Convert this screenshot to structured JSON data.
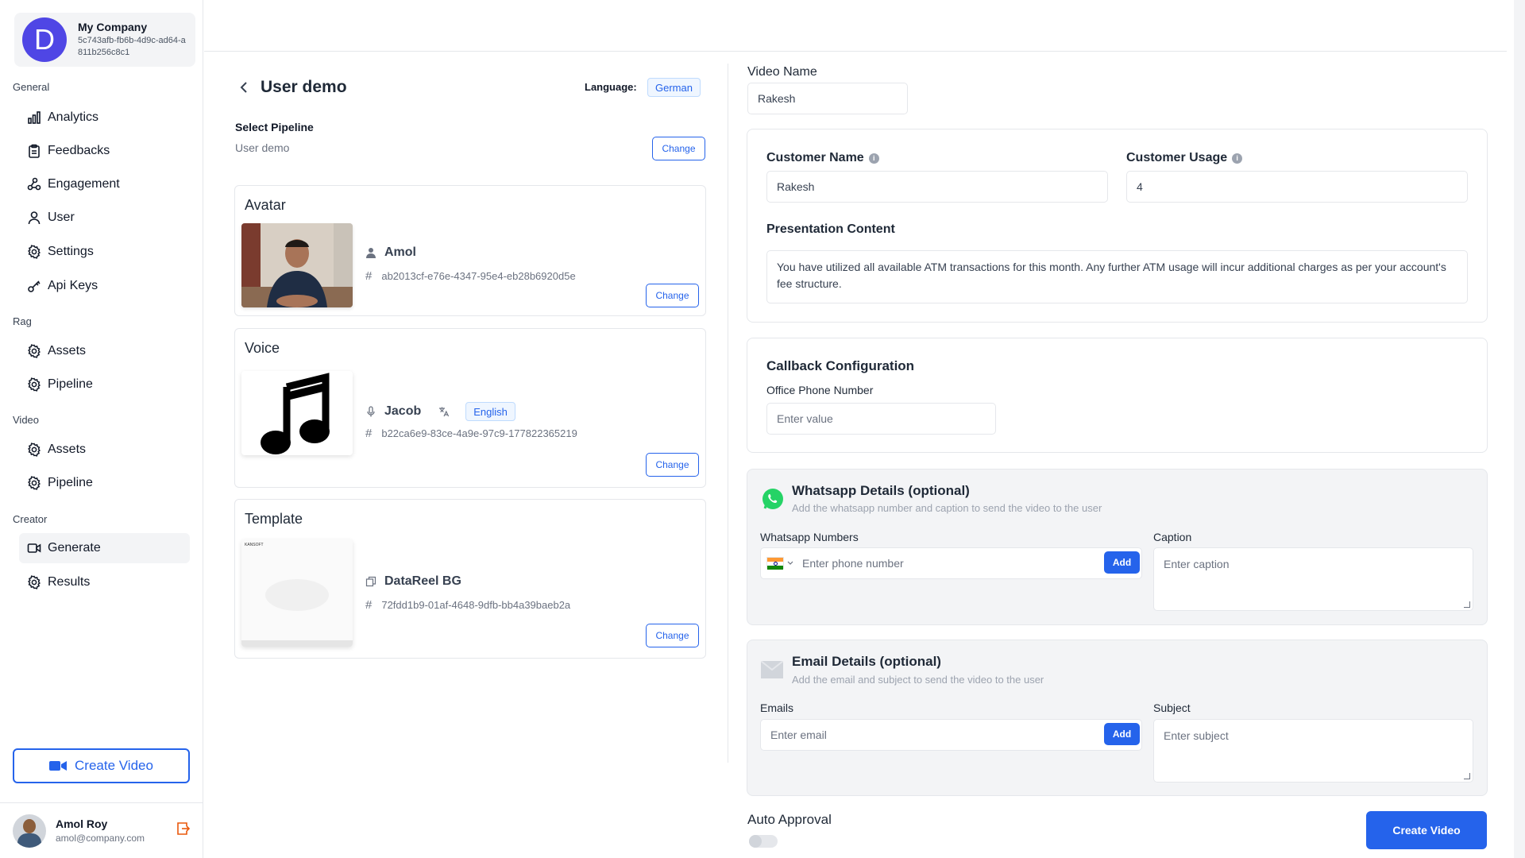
{
  "company": {
    "initial": "D",
    "name": "My Company",
    "id": "5c743afb-fb6b-4d9c-ad64-a811b256c8c1"
  },
  "sidebar": {
    "sections": [
      {
        "label": "General",
        "items": [
          {
            "label": "Analytics",
            "icon": "bar-chart-icon"
          },
          {
            "label": "Feedbacks",
            "icon": "clipboard-icon"
          },
          {
            "label": "Engagement",
            "icon": "share-icon"
          },
          {
            "label": "User",
            "icon": "user-icon"
          },
          {
            "label": "Settings",
            "icon": "gear-icon"
          },
          {
            "label": "Api Keys",
            "icon": "key-icon"
          }
        ]
      },
      {
        "label": "Rag",
        "items": [
          {
            "label": "Assets",
            "icon": "gear-icon"
          },
          {
            "label": "Pipeline",
            "icon": "gear-icon"
          }
        ]
      },
      {
        "label": "Video",
        "items": [
          {
            "label": "Assets",
            "icon": "gear-icon"
          },
          {
            "label": "Pipeline",
            "icon": "gear-icon"
          }
        ]
      },
      {
        "label": "Creator",
        "items": [
          {
            "label": "Generate",
            "icon": "video-icon",
            "active": true
          },
          {
            "label": "Results",
            "icon": "gear-icon"
          }
        ]
      }
    ],
    "create_video": "Create Video"
  },
  "user": {
    "name": "Amol Roy",
    "email": "amol@company.com"
  },
  "header": {
    "title": "User demo",
    "language_label": "Language:",
    "language": "German"
  },
  "pipeline": {
    "label": "Select Pipeline",
    "value": "User demo",
    "change": "Change"
  },
  "avatar": {
    "title": "Avatar",
    "name": "Amol",
    "id": "ab2013cf-e76e-4347-95e4-eb28b6920d5e",
    "change": "Change"
  },
  "voice": {
    "title": "Voice",
    "name": "Jacob",
    "language": "English",
    "id": "b22ca6e9-83ce-4a9e-97c9-177822365219",
    "change": "Change"
  },
  "template": {
    "title": "Template",
    "name": "DataReel BG",
    "id": "72fdd1b9-01af-4648-9dfb-bb4a39baeb2a",
    "change": "Change",
    "thumb_brand": "KANSOFT"
  },
  "video_name": {
    "label": "Video Name",
    "value": "Rakesh"
  },
  "customer": {
    "name_label": "Customer Name",
    "name_value": "Rakesh",
    "usage_label": "Customer Usage",
    "usage_value": "4",
    "content_label": "Presentation Content",
    "content_value": "You have utilized all available ATM transactions for this month. Any further ATM usage will incur additional charges as per your account's fee structure."
  },
  "callback": {
    "title": "Callback Configuration",
    "phone_label": "Office Phone Number",
    "phone_placeholder": "Enter value"
  },
  "whatsapp": {
    "title": "Whatsapp Details (optional)",
    "subtitle": "Add the whatsapp number and caption to send the video to the user",
    "numbers_label": "Whatsapp Numbers",
    "phone_placeholder": "Enter phone number",
    "add": "Add",
    "caption_label": "Caption",
    "caption_placeholder": "Enter caption"
  },
  "email": {
    "title": "Email Details (optional)",
    "subtitle": "Add the email and subject to send the video to the user",
    "emails_label": "Emails",
    "email_placeholder": "Enter email",
    "add": "Add",
    "subject_label": "Subject",
    "subject_placeholder": "Enter subject"
  },
  "auto_approval": {
    "label": "Auto Approval",
    "enabled": false
  },
  "submit": "Create Video",
  "colors": {
    "accent": "#2563eb",
    "company_logo": "#4f46e5",
    "whatsapp": "#25d366"
  }
}
